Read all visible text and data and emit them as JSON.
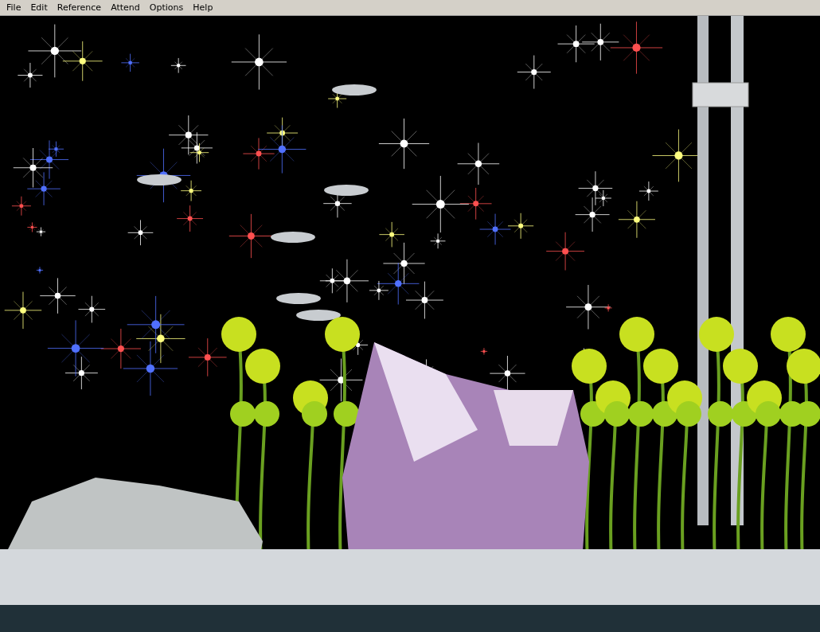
{
  "menu_bar": {
    "items": [
      {
        "label": "File"
      },
      {
        "label": "Edit"
      },
      {
        "label": "Reference"
      },
      {
        "label": "Attend"
      },
      {
        "label": "Options"
      },
      {
        "label": "Help"
      }
    ]
  }
}
